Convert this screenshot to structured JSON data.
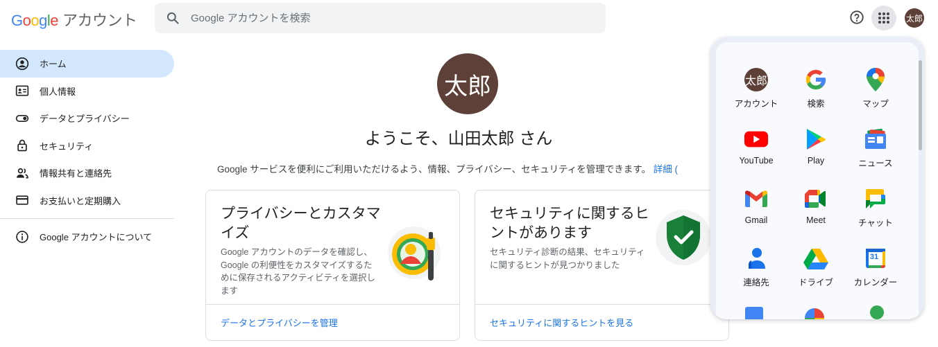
{
  "header": {
    "logo_google": "Google",
    "logo_product": "アカウント",
    "search_placeholder": "Google アカウントを検索",
    "avatar_initials": "太郎",
    "icons": [
      "search-icon",
      "help-icon",
      "apps-grid-icon"
    ]
  },
  "sidebar": {
    "items": [
      {
        "label": "ホーム",
        "icon": "home-user-icon",
        "active": true
      },
      {
        "label": "個人情報",
        "icon": "id-card-icon"
      },
      {
        "label": "データとプライバシー",
        "icon": "toggle-icon"
      },
      {
        "label": "セキュリティ",
        "icon": "lock-icon"
      },
      {
        "label": "情報共有と連絡先",
        "icon": "people-icon"
      },
      {
        "label": "お支払いと定期購入",
        "icon": "credit-card-icon"
      }
    ],
    "about": {
      "label": "Google アカウントについて",
      "icon": "info-icon"
    }
  },
  "main": {
    "avatar_initials": "太郎",
    "welcome": "ようこそ、山田太郎 さん",
    "subtitle": "Google サービスを便利にご利用いただけるよう、情報、プライバシー、セキュリティを管理できます。",
    "subtitle_link": "詳細 (",
    "cards": [
      {
        "title": "プライバシーとカスタマイズ",
        "desc": "Google アカウントのデータを確認し、Google の利便性をカスタマイズするために保存されるアクティビティを選択します",
        "link": "データとプライバシーを管理"
      },
      {
        "title": "セキュリティに関するヒントがあります",
        "desc": "セキュリティ診断の結果、セキュリティに関するヒントが見つかりました",
        "link": "セキュリティに関するヒントを見る"
      }
    ]
  },
  "apps_panel": {
    "apps": [
      {
        "label": "アカウント",
        "icon": "account-avatar-icon"
      },
      {
        "label": "検索",
        "icon": "google-g-icon"
      },
      {
        "label": "マップ",
        "icon": "maps-pin-icon"
      },
      {
        "label": "YouTube",
        "icon": "youtube-icon"
      },
      {
        "label": "Play",
        "icon": "play-store-icon"
      },
      {
        "label": "ニュース",
        "icon": "news-icon"
      },
      {
        "label": "Gmail",
        "icon": "gmail-icon"
      },
      {
        "label": "Meet",
        "icon": "meet-icon"
      },
      {
        "label": "チャット",
        "icon": "chat-icon"
      },
      {
        "label": "連絡先",
        "icon": "contacts-icon"
      },
      {
        "label": "ドライブ",
        "icon": "drive-icon"
      },
      {
        "label": "カレンダー",
        "icon": "calendar-icon"
      }
    ],
    "calendar_day": "31",
    "account_initials": "太郎"
  },
  "colors": {
    "accent": "#1a73e8",
    "active_nav": "#d3e8fd",
    "avatar_bg": "#5d4037"
  }
}
